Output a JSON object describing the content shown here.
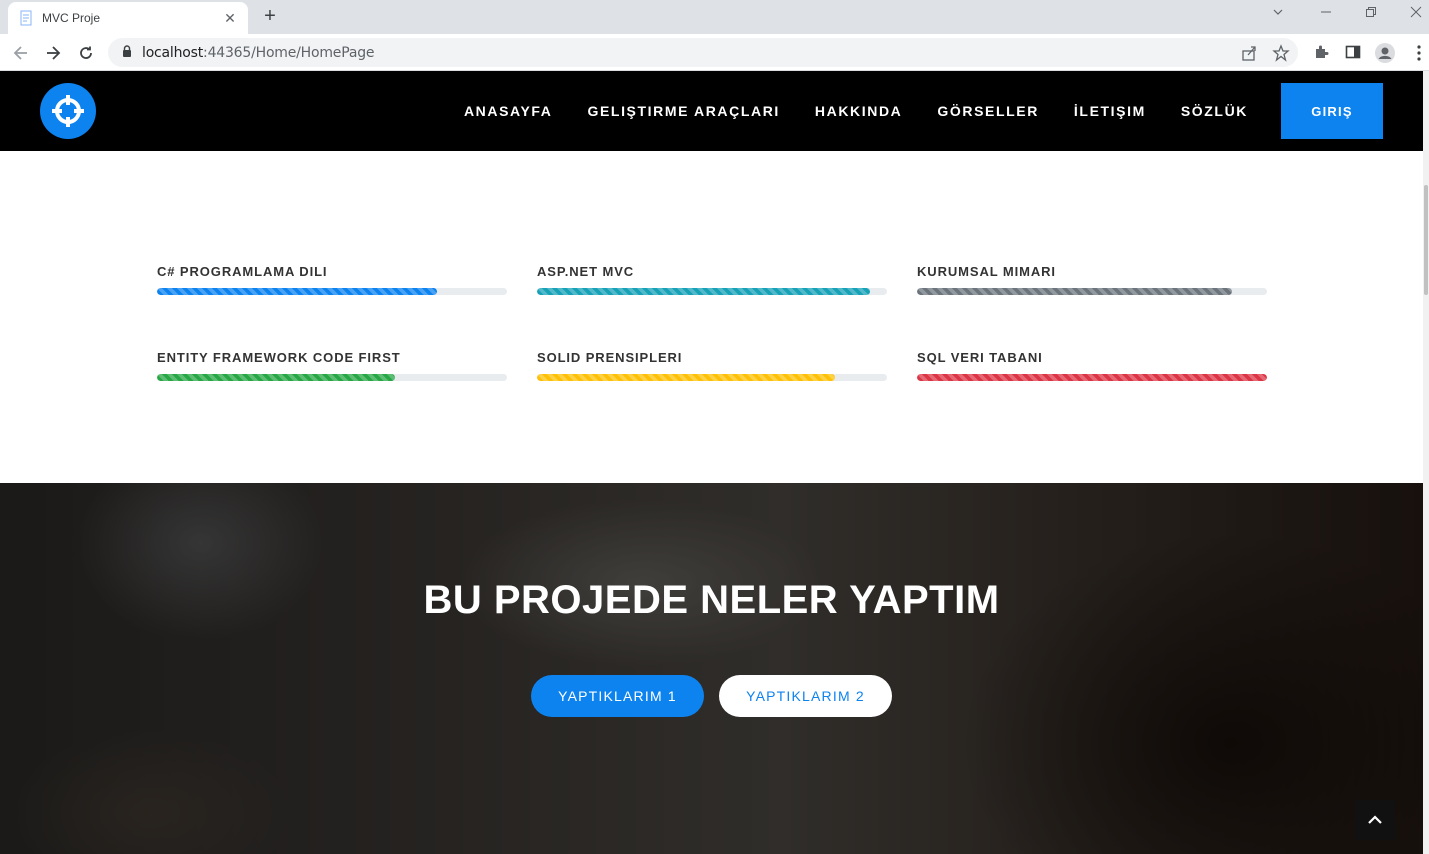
{
  "browser": {
    "tab_title": "MVC Proje",
    "url_host": "localhost",
    "url_rest": ":44365/Home/HomePage"
  },
  "header": {
    "nav": [
      "ANASAYFA",
      "GELIŞTIRME ARAÇLARI",
      "HAKKINDA",
      "GÖRSELLER",
      "İLETIŞIM",
      "SÖZLÜK"
    ],
    "login": "GIRIŞ"
  },
  "skills": [
    {
      "name": "C# PROGRAMLAMA DILI",
      "percent": 80,
      "color": "#0d83f0"
    },
    {
      "name": "ASP.NET MVC",
      "percent": 95,
      "color": "#17a2b8"
    },
    {
      "name": "KURUMSAL MIMARI",
      "percent": 90,
      "color": "#6c757d"
    },
    {
      "name": "ENTITY FRAMEWORK CODE FIRST",
      "percent": 68,
      "color": "#28a745"
    },
    {
      "name": "SOLID PRENSIPLERI",
      "percent": 85,
      "color": "#ffc107"
    },
    {
      "name": "SQL VERI TABANI",
      "percent": 100,
      "color": "#dc3545"
    }
  ],
  "hero": {
    "title": "BU PROJEDE NELER YAPTIM",
    "button1": "YAPTIKLARIM 1",
    "button2": "YAPTIKLARIM 2"
  }
}
